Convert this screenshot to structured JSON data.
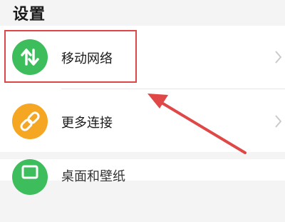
{
  "page": {
    "title": "设置"
  },
  "settings": {
    "items": [
      {
        "label": "移动网络",
        "icon": "mobile-data-arrows-icon",
        "color": "#3dbd5c"
      },
      {
        "label": "更多连接",
        "icon": "link-icon",
        "color": "#f5a623"
      },
      {
        "label": "桌面和壁纸",
        "icon": "wallpaper-icon",
        "color": "#3dbd5c"
      }
    ]
  },
  "colors": {
    "highlight": "#de4747",
    "background": "#f4f4f4",
    "card": "#ffffff"
  }
}
